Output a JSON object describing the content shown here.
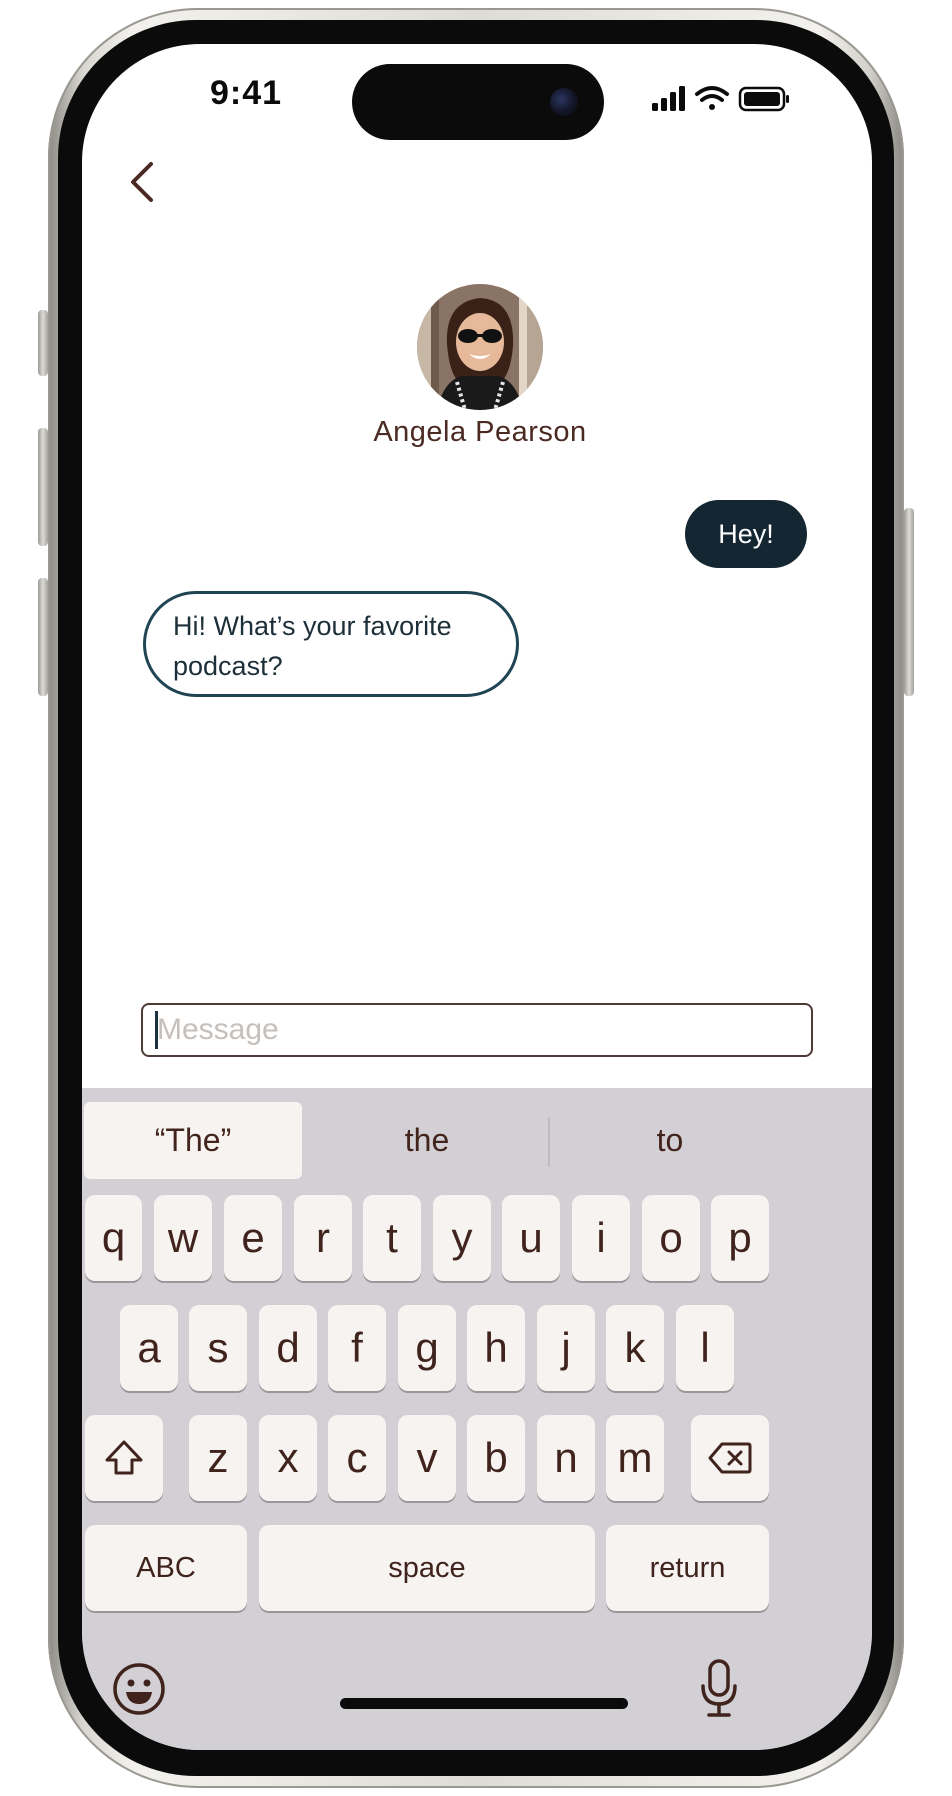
{
  "status_bar": {
    "time": "9:41",
    "icons": [
      "signal-icon",
      "wifi-icon",
      "battery-icon"
    ]
  },
  "nav": {
    "back_icon": "chevron-left-icon"
  },
  "contact": {
    "name": "Angela Pearson",
    "avatar": "contact-photo"
  },
  "messages": [
    {
      "direction": "outgoing",
      "text": "Hey!"
    },
    {
      "direction": "incoming",
      "text": "Hi! What’s your favorite podcast?"
    }
  ],
  "composer": {
    "placeholder": "Message",
    "value": ""
  },
  "keyboard": {
    "predictions": [
      "“The”",
      "the",
      "to"
    ],
    "row1": [
      "q",
      "w",
      "e",
      "r",
      "t",
      "y",
      "u",
      "i",
      "o",
      "p"
    ],
    "row2": [
      "a",
      "s",
      "d",
      "f",
      "g",
      "h",
      "j",
      "k",
      "l"
    ],
    "row3": [
      "z",
      "x",
      "c",
      "v",
      "b",
      "n",
      "m"
    ],
    "abc_label": "ABC",
    "space_label": "space",
    "return_label": "return",
    "shift_icon": "shift-icon",
    "delete_icon": "delete-icon",
    "emoji_icon": "emoji-icon",
    "mic_icon": "microphone-icon"
  },
  "colors": {
    "accent_dark": "#132631",
    "text_brown": "#43241c",
    "keyboard_bg": "#d2d0d4",
    "key_bg": "#f6f3f1"
  }
}
